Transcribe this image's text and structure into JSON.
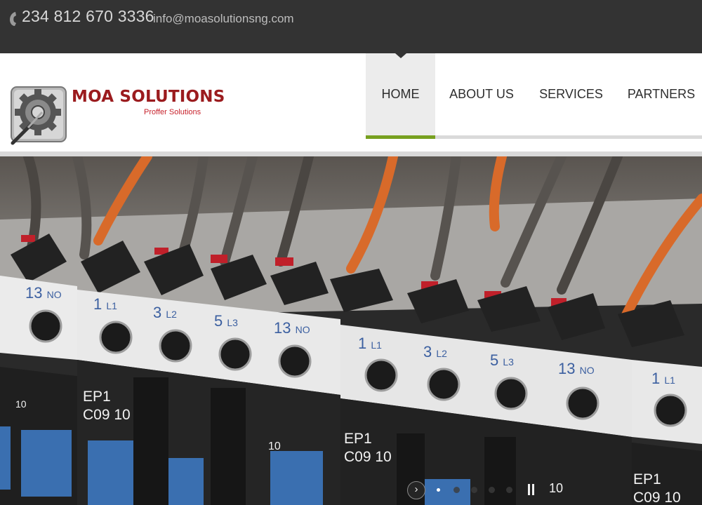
{
  "topbar": {
    "phone": "234 812 670 3336",
    "email": "info@moasolutionsng.com",
    "icon": "phone-icon"
  },
  "header": {
    "brand": "MOA SOLUTIONS",
    "tagline": "Proffer Solutions",
    "logo_icon": "gear-icon"
  },
  "nav": {
    "items": [
      {
        "label": "HOME",
        "active": true
      },
      {
        "label": "ABOUT US",
        "active": false
      },
      {
        "label": "SERVICES",
        "active": false
      },
      {
        "label": "PARTNERS",
        "active": false
      }
    ],
    "accent_color": "#77a01f"
  },
  "hero": {
    "contactors": [
      {
        "terminals": [
          {
            "num": "13",
            "label": "NO"
          }
        ],
        "model": "EP1",
        "rating": "C09 10",
        "aux": "10"
      },
      {
        "terminals": [
          {
            "num": "1",
            "label": "L1"
          },
          {
            "num": "3",
            "label": "L2"
          },
          {
            "num": "5",
            "label": "L3"
          },
          {
            "num": "13",
            "label": "NO"
          }
        ],
        "model": "EP1",
        "rating": "C09 10",
        "aux": "10"
      },
      {
        "terminals": [
          {
            "num": "1",
            "label": "L1"
          },
          {
            "num": "3",
            "label": "L2"
          },
          {
            "num": "5",
            "label": "L3"
          },
          {
            "num": "13",
            "label": "NO"
          }
        ],
        "model": "EP1",
        "rating": "C09 10",
        "aux": "10"
      },
      {
        "terminals": [
          {
            "num": "1",
            "label": "L1"
          }
        ],
        "model": "EP1",
        "rating": "C09 10"
      }
    ]
  },
  "slider": {
    "next_icon": "chevron-right-icon",
    "dot_count": 5,
    "active_dot": 0,
    "pause_icon": "pause-icon"
  }
}
